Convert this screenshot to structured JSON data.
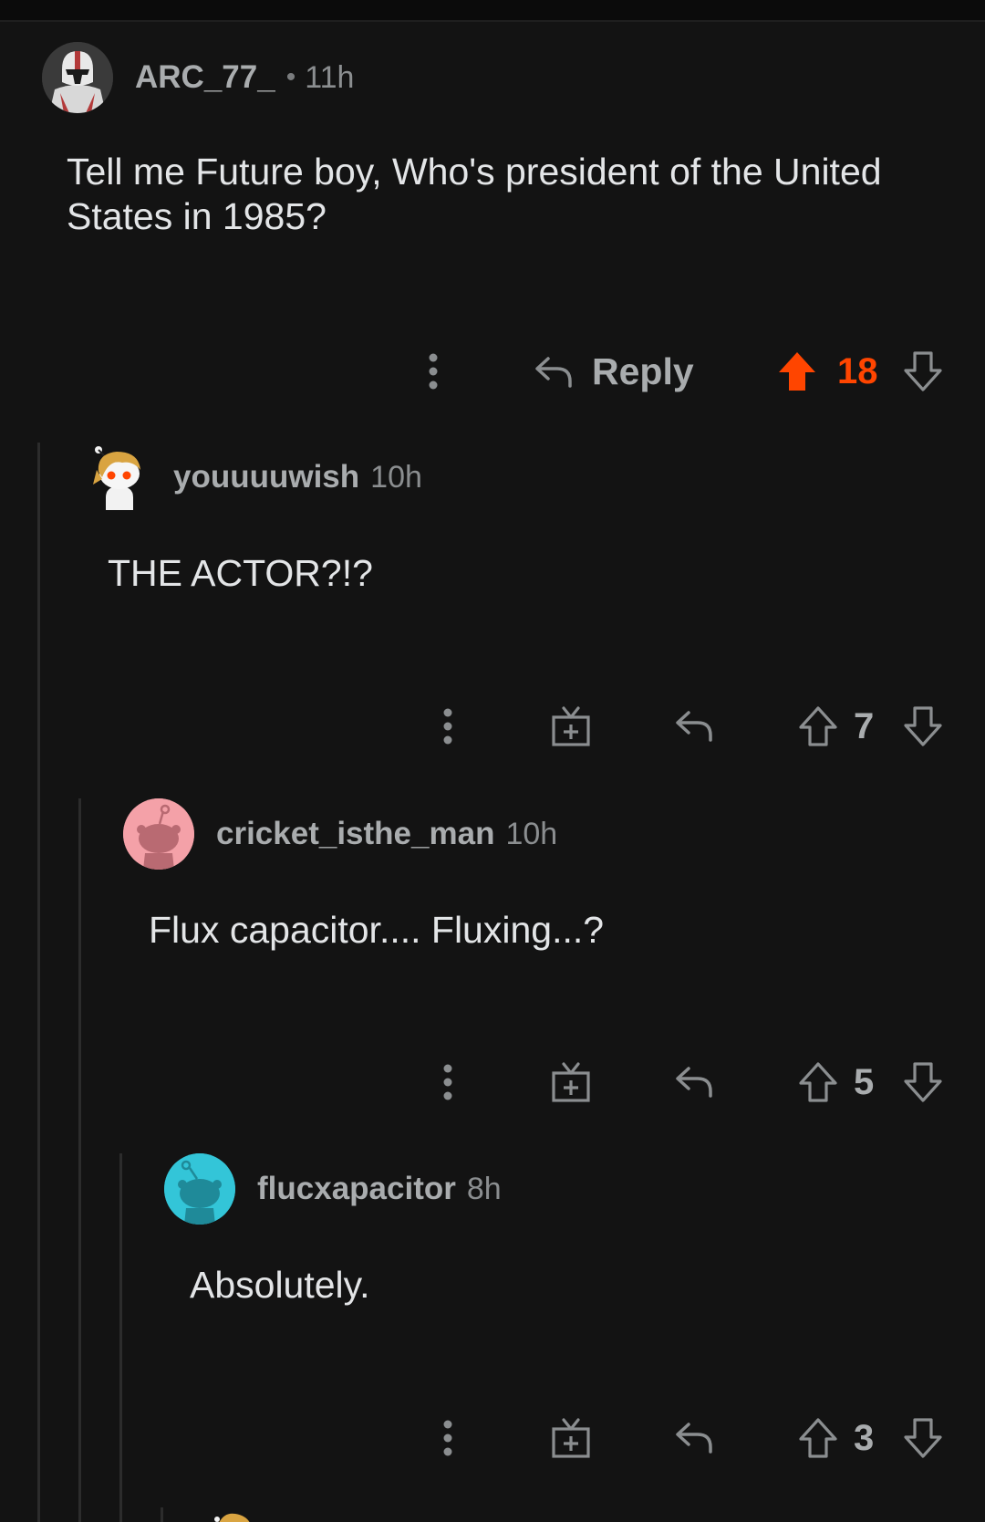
{
  "comments": [
    {
      "username": "ARC_77_",
      "separator": "•",
      "time": "11h",
      "text": "Tell me Future boy, Who's president of the United States in 1985?",
      "reply_label": "Reply",
      "score": "18",
      "upvoted": true,
      "avatar": "clone-trooper-avatar"
    },
    {
      "username": "youuuuwish",
      "time": "10h",
      "text": "THE ACTOR?!?",
      "score": "7",
      "upvoted": false,
      "avatar": "snoo-character-avatar"
    },
    {
      "username": "cricket_isthe_man",
      "time": "10h",
      "text": "Flux capacitor.... Fluxing...?",
      "score": "5",
      "upvoted": false,
      "avatar": "snoo-pink-avatar"
    },
    {
      "username": "flucxapacitor",
      "time": "8h",
      "text": "Absolutely.",
      "score": "3",
      "upvoted": false,
      "avatar": "snoo-cyan-avatar"
    }
  ],
  "colors": {
    "background": "#131313",
    "upvote_active": "#ff4500",
    "icon": "#8b8e90",
    "thread_line": "#2c2c2c",
    "avatar_pink": "#f4a1a8",
    "avatar_cyan": "#33c5d8"
  }
}
